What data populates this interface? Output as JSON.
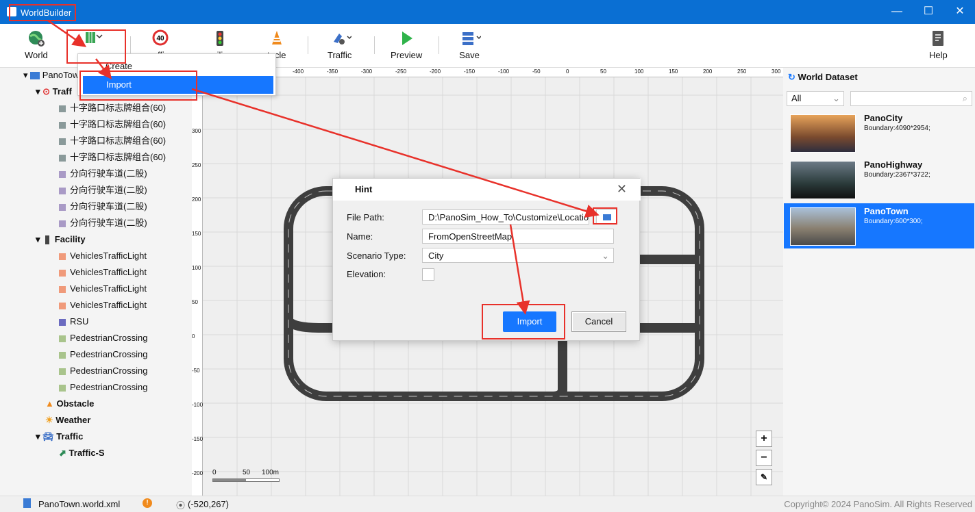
{
  "app": {
    "title": "WorldBuilder"
  },
  "toolbar": {
    "world": "World",
    "traffic": "Traffic",
    "preview": "Preview",
    "save": "Save",
    "help": "Help",
    "partial_sign": "ffi",
    "partial_facility": "ili",
    "partial_obstacle": "tacle"
  },
  "menu": {
    "create": "Create",
    "import": "Import"
  },
  "tree": {
    "root": "PanoTown",
    "traffic_group": "Traff",
    "signs": [
      "十字路口标志牌组合(60)",
      "十字路口标志牌组合(60)",
      "十字路口标志牌组合(60)",
      "十字路口标志牌组合(60)"
    ],
    "lanes": [
      "分向行驶车道(二股)",
      "分向行驶车道(二股)",
      "分向行驶车道(二股)",
      "分向行驶车道(二股)"
    ],
    "facility": "Facility",
    "lights": [
      "VehiclesTrafficLight",
      "VehiclesTrafficLight",
      "VehiclesTrafficLight",
      "VehiclesTrafficLight"
    ],
    "rsu": "RSU",
    "crossings": [
      "PedestrianCrossing",
      "PedestrianCrossing",
      "PedestrianCrossing",
      "PedestrianCrossing"
    ],
    "obstacle": "Obstacle",
    "weather": "Weather",
    "traffic": "Traffic",
    "traffic_s": "Traffic-S"
  },
  "ruler": {
    "top": [
      "-400",
      "-350",
      "-300",
      "-250",
      "-200",
      "-150",
      "-100",
      "-50",
      "0",
      "50",
      "100",
      "150",
      "200",
      "250",
      "300"
    ],
    "left": [
      "300",
      "250",
      "200",
      "150",
      "100",
      "50",
      "0",
      "-50",
      "-100",
      "-150",
      "-200"
    ]
  },
  "scale": {
    "zero": "0",
    "mid": "50",
    "end": "100m"
  },
  "dialog": {
    "title": "Hint",
    "file_path_label": "File Path:",
    "file_path_value": "D:\\PanoSim_How_To\\Customize\\Location",
    "name_label": "Name:",
    "name_value": "FromOpenStreetMap",
    "scenario_label": "Scenario Type:",
    "scenario_value": "City",
    "elevation_label": "Elevation:",
    "import": "Import",
    "cancel": "Cancel"
  },
  "dataset": {
    "title": "World Dataset",
    "filter": "All",
    "items": [
      {
        "name": "PanoCity",
        "boundary": "Boundary:4090*2954;"
      },
      {
        "name": "PanoHighway",
        "boundary": "Boundary:2367*3722;"
      },
      {
        "name": "PanoTown",
        "boundary": "Boundary:600*300;"
      }
    ]
  },
  "status": {
    "file": "PanoTown.world.xml",
    "coords": "(-520,267)",
    "copyright": "Copyright© 2024 PanoSim. All Rights Reserved"
  },
  "colors": {
    "accent": "#0a6fd3",
    "selected": "#1677ff",
    "annotation": "#e8312a"
  }
}
